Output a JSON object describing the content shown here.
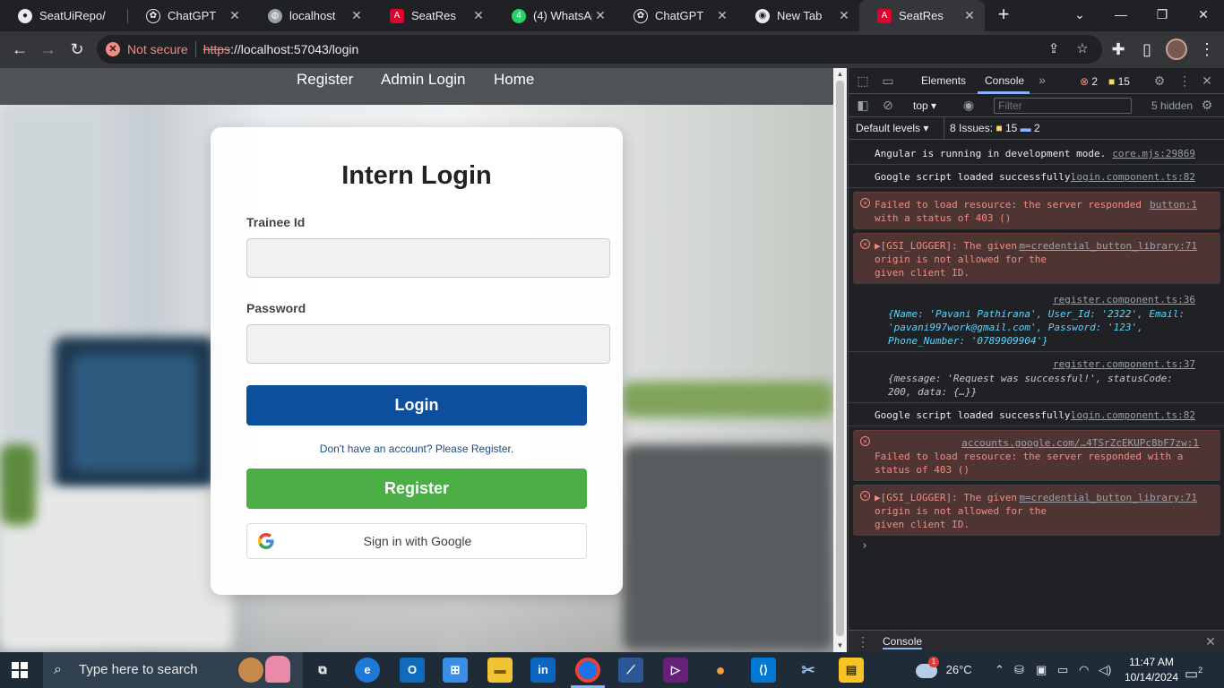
{
  "browser": {
    "tabs": [
      {
        "title": "SeatUiRepo/",
        "icon": "github-icon",
        "color": "#e8eaed"
      },
      {
        "title": "ChatGPT",
        "icon": "chatgpt-icon",
        "color": "#e8eaed"
      },
      {
        "title": "localhost",
        "icon": "globe-icon",
        "color": "#9aa0a6"
      },
      {
        "title": "SeatRes",
        "icon": "angular-icon",
        "color": "#dd0031"
      },
      {
        "title": "(4) WhatsAp",
        "icon": "whatsapp-icon",
        "color": "#25d366"
      },
      {
        "title": "ChatGPT",
        "icon": "chatgpt-icon",
        "color": "#e8eaed"
      },
      {
        "title": "New Tab",
        "icon": "chrome-icon",
        "color": "#e8eaed"
      },
      {
        "title": "SeatRes",
        "icon": "angular-icon",
        "color": "#dd0031"
      }
    ],
    "not_secure": "Not secure",
    "url_scheme": "https",
    "url_rest": "://localhost:57043/login"
  },
  "site": {
    "nav": [
      "Register",
      "Admin Login",
      "Home"
    ],
    "title": "Intern Login",
    "trainee_label": "Trainee Id",
    "password_label": "Password",
    "login_button": "Login",
    "register_hint": "Don't have an account? Please Register.",
    "register_button": "Register",
    "google_button": "Sign in with Google"
  },
  "devtools": {
    "tab_elements": "Elements",
    "tab_console": "Console",
    "errors_count": "2",
    "warnings_count": "15",
    "context": "top",
    "filter_placeholder": "Filter",
    "hidden_count": "5 hidden",
    "default_levels": "Default levels",
    "issues_label": "8 Issues:",
    "issues_warn": "15",
    "issues_info": "2",
    "drawer_title": "Console",
    "messages": {
      "m1_text": "Angular is running in development mode.",
      "m1_src": "core.mjs:29869",
      "m2_text": "Google script loaded successfully.",
      "m2_src": "login.component.ts:82",
      "m3_text": "Failed to load resource: the server responded with a status of 403 ()",
      "m3_src": "button:1",
      "m4_text": "▶[GSI_LOGGER]: The given origin is not allowed for the given client ID.",
      "m4_src": "m=credential_button_library:71",
      "m5_src": "register.component.ts:36",
      "m5_obj": "{Name: 'Pavani Pathirana', User_Id: '2322', Email: 'pavani997work@gmail.com', Password: '123', Phone_Number: '0789909904'}",
      "m6_src": "register.component.ts:37",
      "m6_obj": "{message: 'Request was successful!', statusCode: 200, data: {…}}",
      "m7_text": "Google script loaded successfully.",
      "m7_src": "login.component.ts:82",
      "m8_text": "Failed to load resource: the server responded with a status of 403 ()",
      "m8_src": "accounts.google.com/…4TSrZcEKUPc8bF7zw:1",
      "m9_text": "▶[GSI_LOGGER]: The given origin is not allowed for the given client ID.",
      "m9_src": "m=credential_button_library:71"
    }
  },
  "taskbar": {
    "search_placeholder": "Type here to search",
    "weather": "26°C",
    "weather_badge": "1",
    "time": "11:47 AM",
    "date": "10/14/2024",
    "notification_count": "2"
  },
  "colors": {
    "login_button": "#0d4f9e",
    "register_button": "#4caf45",
    "error_text": "#f28b82"
  }
}
